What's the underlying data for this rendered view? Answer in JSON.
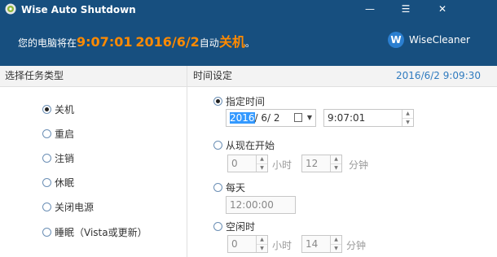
{
  "app": {
    "title": "Wise Auto Shutdown"
  },
  "window_controls": {
    "minimize": "—",
    "menu": "☰",
    "close": "✕"
  },
  "banner": {
    "prefix": "您的电脑将在",
    "time": "9:07:01",
    "date": "2016/6/2",
    "mid": "自动",
    "action": "关机",
    "suffix": "。"
  },
  "brand": {
    "logo": "W",
    "name": "WiseCleaner"
  },
  "left_panel": {
    "title": "选择任务类型",
    "options": [
      {
        "label": "关机",
        "selected": true
      },
      {
        "label": "重启",
        "selected": false
      },
      {
        "label": "注销",
        "selected": false
      },
      {
        "label": "休眠",
        "selected": false
      },
      {
        "label": "关闭电源",
        "selected": false
      },
      {
        "label": "睡眠（Vista或更新）",
        "selected": false
      }
    ]
  },
  "right_panel": {
    "title": "时间设定",
    "current_datetime": "2016/6/2 9:09:30",
    "specified_time": {
      "label": "指定时间",
      "date_year": "2016",
      "date_rest": "/  6/  2",
      "time": "9:07:01"
    },
    "from_now": {
      "label": "从现在开始",
      "hours": "0",
      "hours_unit": "小时",
      "minutes": "12",
      "minutes_unit": "分钟"
    },
    "daily": {
      "label": "每天",
      "time": "12:00:00"
    },
    "idle": {
      "label": "空闲时",
      "hours": "0",
      "hours_unit": "小时",
      "minutes": "14",
      "minutes_unit": "分钟"
    }
  },
  "colors": {
    "header_bg": "#174f7f",
    "accent_orange": "#ff8a00",
    "datetime_blue": "#2f7bbf"
  }
}
